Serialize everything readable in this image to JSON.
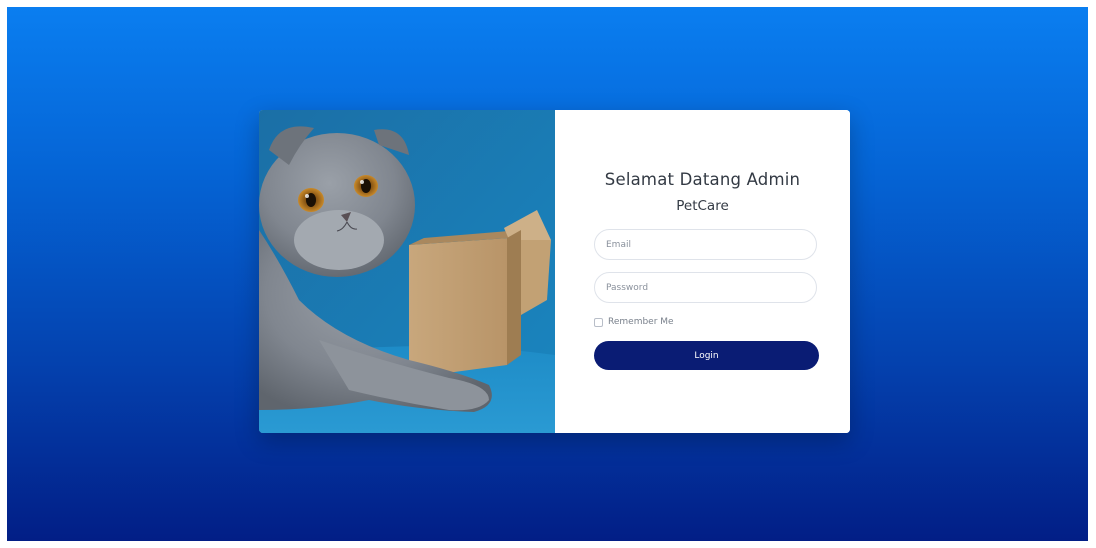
{
  "login": {
    "title": "Selamat Datang Admin",
    "subtitle": "PetCare",
    "email_placeholder": "Email",
    "password_placeholder": "Password",
    "remember_label": "Remember Me",
    "login_label": "Login"
  },
  "hero_image": {
    "subject": "grey scottish fold kitten beside cardboard box on blue background"
  },
  "colors": {
    "background_top": "#0a7ef0",
    "background_bottom": "#021e86",
    "button": "#0a1c74",
    "photo_background": "#1a78b3"
  }
}
